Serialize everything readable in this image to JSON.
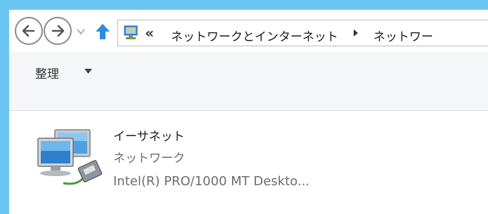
{
  "colors": {
    "window_border": "#6cc6f3",
    "toolbar_bg": "#f5f6f7",
    "secondary_text": "#6d6d6d",
    "up_arrow": "#2a8de0"
  },
  "navigation": {
    "back_icon": "left-arrow-icon",
    "forward_icon": "right-arrow-icon",
    "recent_icon": "chevron-down-icon",
    "up_icon": "up-arrow-icon"
  },
  "address_bar": {
    "location_icon": "network-folder-icon",
    "overflow_label": "«",
    "breadcrumbs": [
      "ネットワークとインターネット",
      "ネットワー"
    ]
  },
  "toolbar": {
    "organize_label": "整理"
  },
  "items": [
    {
      "name": "イーサネット",
      "status": "ネットワーク",
      "device": "Intel(R) PRO/1000 MT Deskto...",
      "icon": "network-adapter-icon"
    }
  ]
}
